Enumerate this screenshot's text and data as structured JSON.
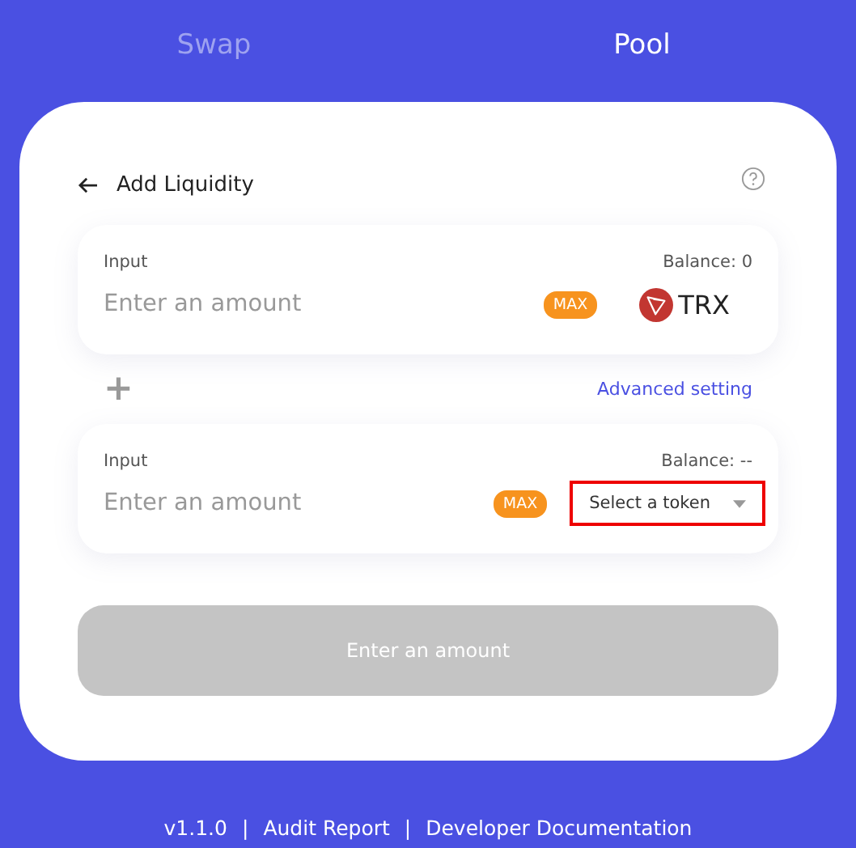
{
  "tabs": [
    {
      "label": "Swap",
      "selected": false
    },
    {
      "label": "Pool",
      "selected": true
    }
  ],
  "header": {
    "title": "Add Liquidity"
  },
  "inputs": [
    {
      "label": "Input",
      "balance": "Balance: 0",
      "placeholder": "Enter an amount",
      "max": "MAX",
      "token": {
        "kind": "token",
        "symbol": "TRX"
      },
      "highlighted": false
    },
    {
      "label": "Input",
      "balance": "Balance: --",
      "placeholder": "Enter an amount",
      "max": "MAX",
      "token": {
        "kind": "select",
        "text": "Select a token"
      },
      "highlighted": true
    }
  ],
  "plus": "+",
  "advanced_link": "Advanced setting",
  "submit": {
    "label": "Enter an amount",
    "disabled": true
  },
  "footer": {
    "version": "v1.1.0",
    "links": [
      "Audit Report",
      "Developer Documentation"
    ],
    "separator": "|"
  }
}
